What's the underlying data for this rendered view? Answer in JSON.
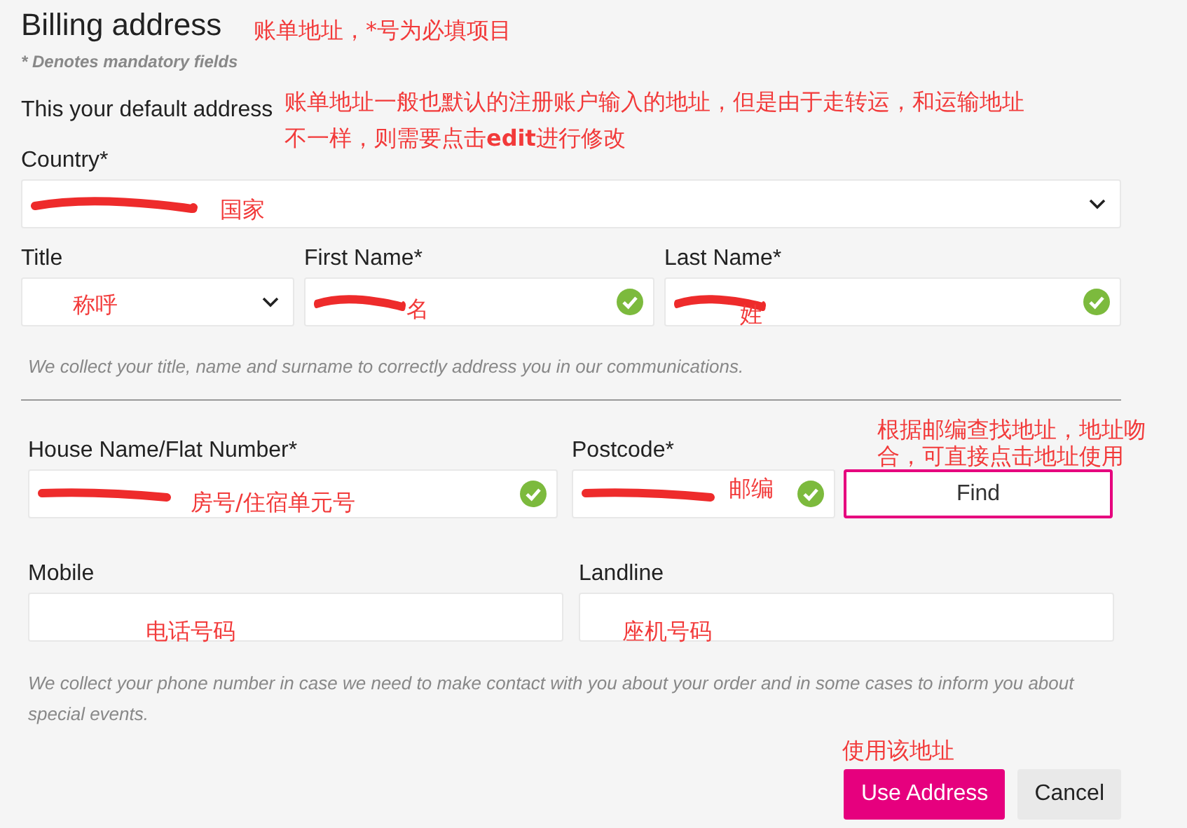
{
  "title": "Billing address",
  "mandatory_note": "* Denotes mandatory fields",
  "default_note": "This your default address",
  "name_rows": [
    [
      {
        "kind": "select",
        "label": "Country*",
        "redacted": true,
        "valid": false
      }
    ],
    [
      {
        "kind": "select",
        "label": "Title",
        "redacted": false,
        "valid": false
      },
      {
        "kind": "text",
        "label": "First Name*",
        "redacted": true,
        "valid": true
      },
      {
        "kind": "text",
        "label": "Last Name*",
        "redacted": true,
        "valid": true
      }
    ]
  ],
  "name_hint": "We collect your title, name and surname to correctly address you in our communications.",
  "contact_rows": [
    [
      {
        "kind": "text",
        "label": "House Name/Flat Number*",
        "redacted": true,
        "valid": true
      },
      {
        "kind": "text",
        "label": "Postcode*",
        "redacted": true,
        "valid": true
      },
      {
        "kind": "button",
        "label": "Find"
      }
    ],
    [
      {
        "kind": "text",
        "label": "Mobile",
        "redacted": false,
        "valid": false
      },
      {
        "kind": "text",
        "label": "Landline",
        "redacted": false,
        "valid": false
      }
    ]
  ],
  "contact_hint": "We collect your phone number in case we need to make contact with you about your order and in some cases to inform you about special events.",
  "buttons": [
    {
      "label": "Use Address",
      "primary": true
    },
    {
      "label": "Cancel",
      "primary": false
    }
  ],
  "annotations": [
    "账单地址，*号为必填项目",
    "账单地址一般也默认的注册账户输入的地址，但是由于走转运，和运输地址不一样，则需要点击**edit**进行修改",
    "国家",
    "称呼",
    "名",
    "姓",
    "根据邮编查找地址，地址吻合，可直接点击地址使用",
    "房号/住宿单元号",
    "邮编",
    "电话号码",
    "座机号码",
    "使用该地址"
  ]
}
